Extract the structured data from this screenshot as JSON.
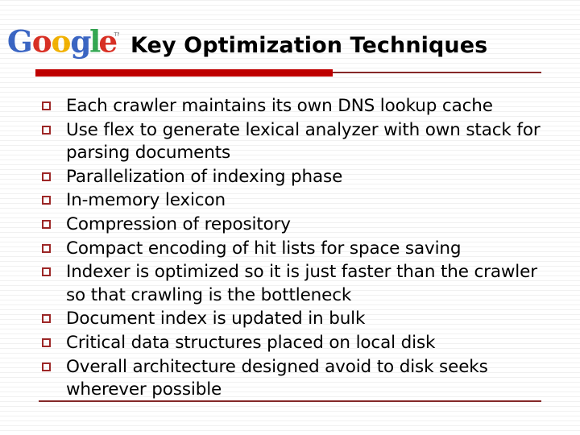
{
  "slide": {
    "title": "Key Optimization Techniques",
    "logo": {
      "name": "google-logo",
      "wordmark": "Google",
      "trademark": "TM",
      "letter_colors": {
        "G": "#3B66C4",
        "o1": "#D93025",
        "o2": "#F2B203",
        "g": "#3B66C4",
        "l": "#34A853",
        "e": "#D93025"
      }
    },
    "colors": {
      "accent_red_bar": "#C00000",
      "rule_dark_red": "#8A2A2A",
      "bullet_marker": "#9E2727",
      "text": "#000000",
      "background": "#FFFFFF"
    },
    "bullets": [
      {
        "marker": "hollow-square",
        "text": "Each crawler maintains its own DNS lookup cache"
      },
      {
        "marker": "hollow-square",
        "text": "Use flex to generate lexical analyzer with own stack for parsing documents"
      },
      {
        "marker": "hollow-square",
        "text": "Parallelization of indexing phase"
      },
      {
        "marker": "hollow-square",
        "text": "In-memory lexicon"
      },
      {
        "marker": "hollow-square",
        "text": "Compression of repository"
      },
      {
        "marker": "hollow-square",
        "text": "Compact encoding of hit lists for space saving"
      },
      {
        "marker": "hollow-square",
        "text": "Indexer is optimized so it is just faster than the crawler so that crawling is the bottleneck"
      },
      {
        "marker": "hollow-square",
        "text": "Document index is updated in bulk"
      },
      {
        "marker": "hollow-square",
        "text": "Critical data structures placed on local disk"
      },
      {
        "marker": "hollow-square",
        "text": "Overall architecture designed avoid to disk seeks wherever possible"
      }
    ]
  }
}
